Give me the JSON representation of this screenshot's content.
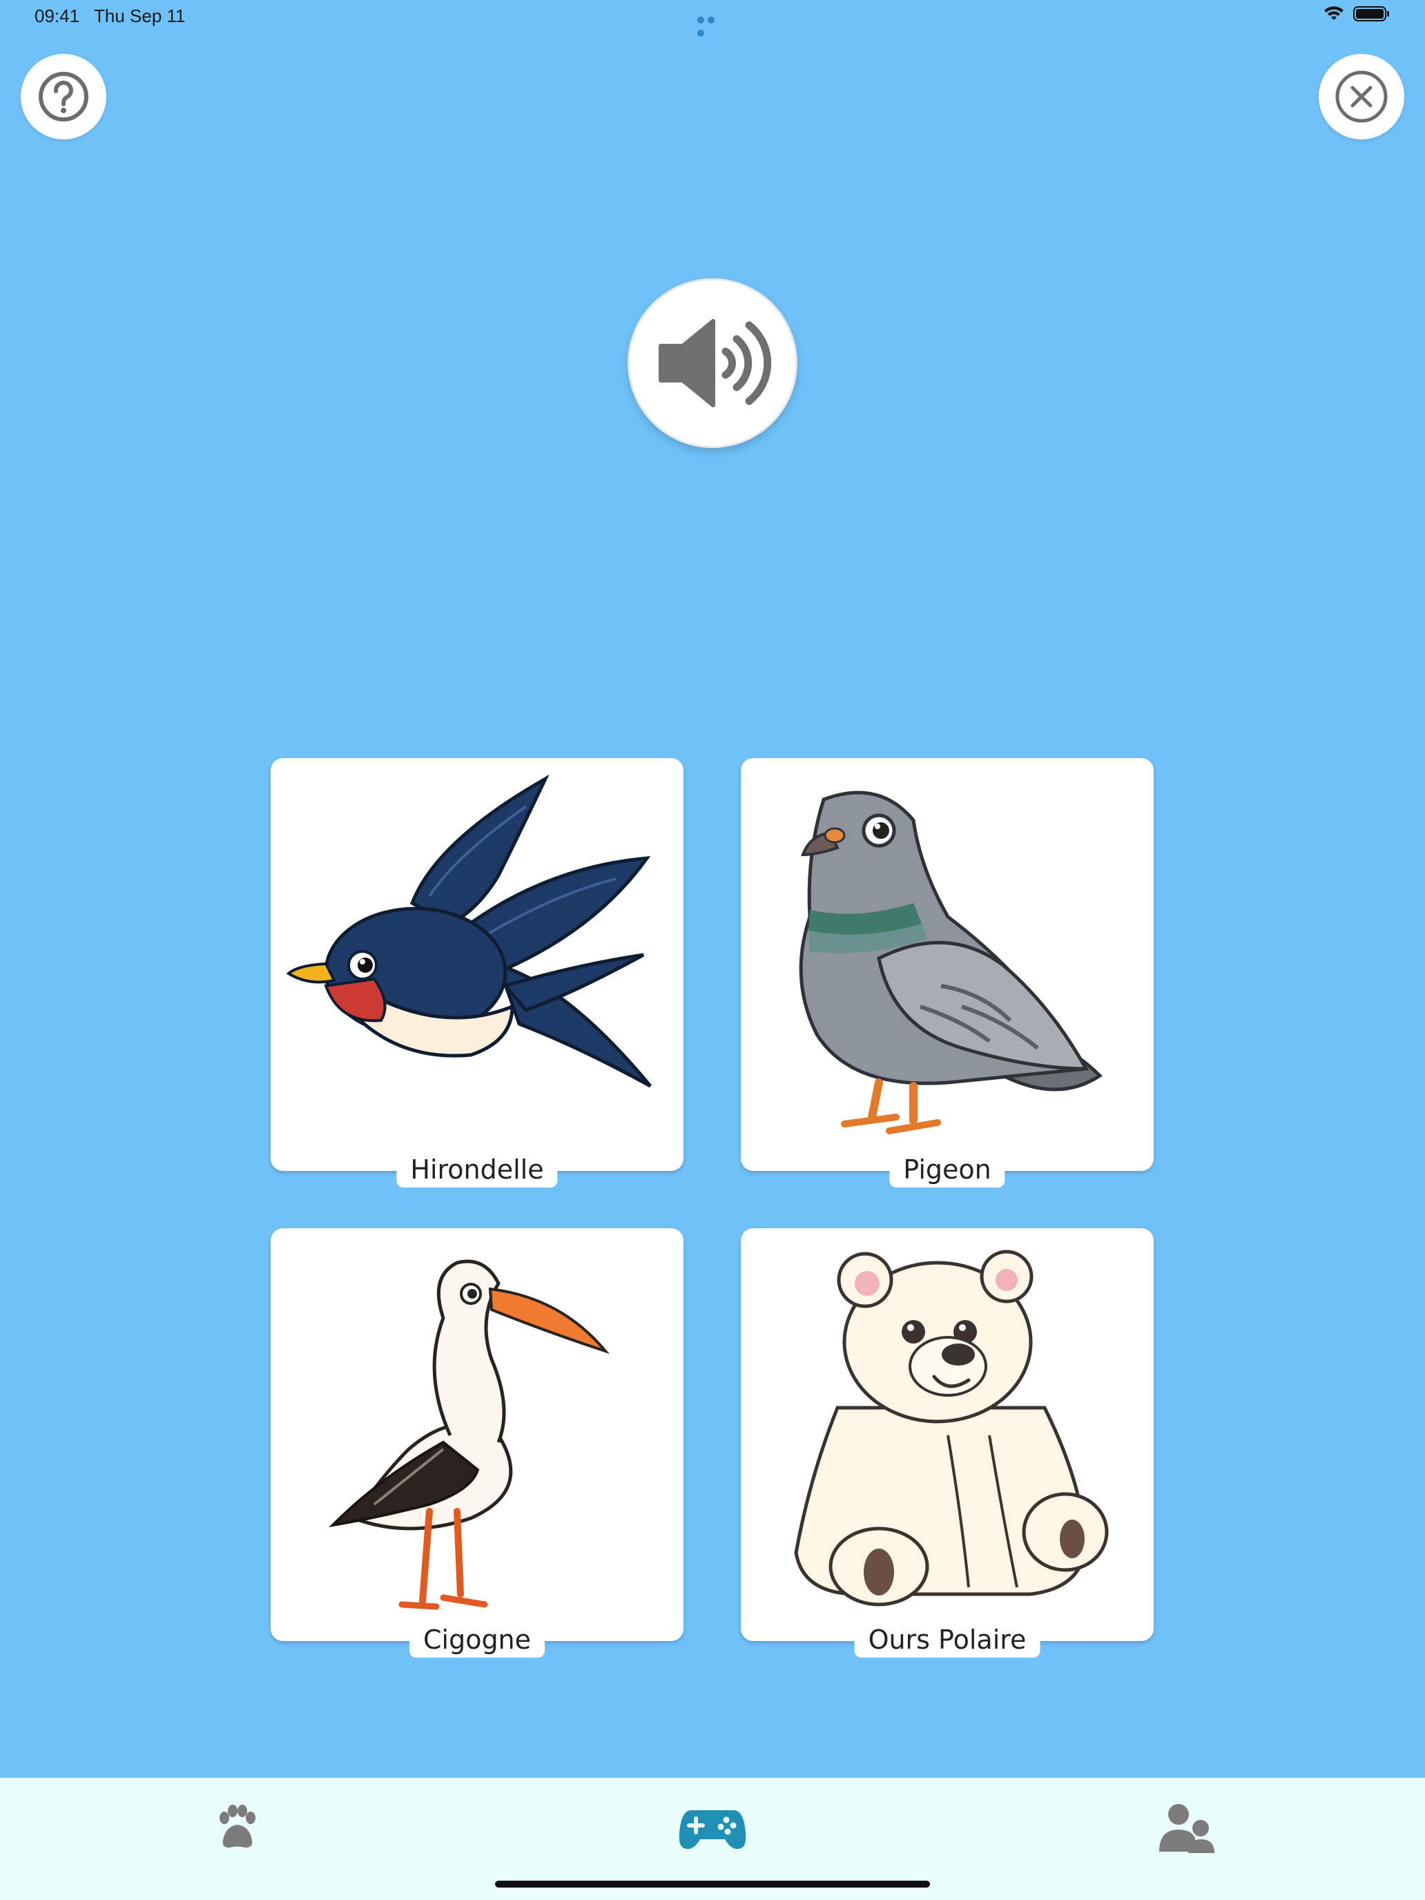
{
  "status_bar": {
    "time": "09:41",
    "date": "Thu Sep 11",
    "icons": [
      "wifi-icon",
      "battery-icon"
    ]
  },
  "header": {
    "help_icon": "question-circle-icon",
    "close_icon": "close-circle-icon"
  },
  "sound_button": {
    "icon": "speaker-volume-icon"
  },
  "cards": [
    {
      "label": "Hirondelle",
      "image": "swallow"
    },
    {
      "label": "Pigeon",
      "image": "pigeon"
    },
    {
      "label": "Cigogne",
      "image": "stork"
    },
    {
      "label": "Ours Polaire",
      "image": "polar-bear"
    }
  ],
  "tab_bar": {
    "tabs": [
      {
        "icon": "paw-icon",
        "selected": false
      },
      {
        "icon": "gamepad-icon",
        "selected": true
      },
      {
        "icon": "profiles-icon",
        "selected": false
      }
    ]
  },
  "colors": {
    "background": "#6fc1f8",
    "tab_bar": "#e9fdfd",
    "tab_selected": "#1f8fb4",
    "tab_unselected": "#7c7c7c",
    "icon_gray": "#6d6d6d"
  }
}
